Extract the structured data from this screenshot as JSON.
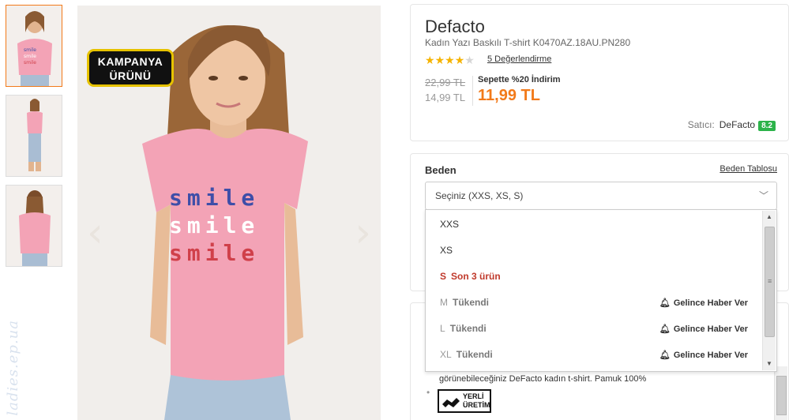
{
  "gallery": {
    "thumbnails": [
      "thumb-front",
      "thumb-full",
      "thumb-back"
    ],
    "badge_line1": "KAMPANYA",
    "badge_line2": "ÜRÜNÜ",
    "prev_arrow": "‹",
    "next_arrow": "›",
    "watermark": "ladies.ep.ua"
  },
  "product": {
    "brand": "Defacto",
    "name": "Kadın Yazı Baskılı T-shirt K0470AZ.18AU.PN280",
    "rating": 4,
    "rating_max": 5,
    "reviews_link": "5 Değerlendirme",
    "old_price": "22,99 TL",
    "current_price": "14,99 TL",
    "basket_discount_label": "Sepette %20 İndirim",
    "basket_price": "11,99 TL",
    "seller_label": "Satıcı:",
    "seller_name": "DeFacto",
    "seller_score": "8.2"
  },
  "size": {
    "title": "Beden",
    "chart_link": "Beden Tablosu",
    "select_placeholder": "Seçiniz (XXS, XS, S)",
    "options": [
      {
        "size": "XXS",
        "status": ""
      },
      {
        "size": "XS",
        "status": ""
      },
      {
        "size": "S",
        "status": "Son 3 ürün"
      },
      {
        "size": "M",
        "status": "Tükendi",
        "notify": "Gelince Haber Ver"
      },
      {
        "size": "L",
        "status": "Tükendi",
        "notify": "Gelince Haber Ver"
      },
      {
        "size": "XL",
        "status": "Tükendi",
        "notify": "Gelince Haber Ver"
      }
    ]
  },
  "description": {
    "partial_text": "görünebileceğiniz DeFacto kadın t-shirt. Pamuk 100%",
    "local_badge_line1": "YERLİ",
    "local_badge_line2": "ÜRETİM"
  },
  "colors": {
    "accent": "#f27a1a",
    "star": "#f5b301",
    "stock_warning": "#c0392b",
    "seller_score_bg": "#2cb34a",
    "shirt": "#f3a3b6"
  }
}
